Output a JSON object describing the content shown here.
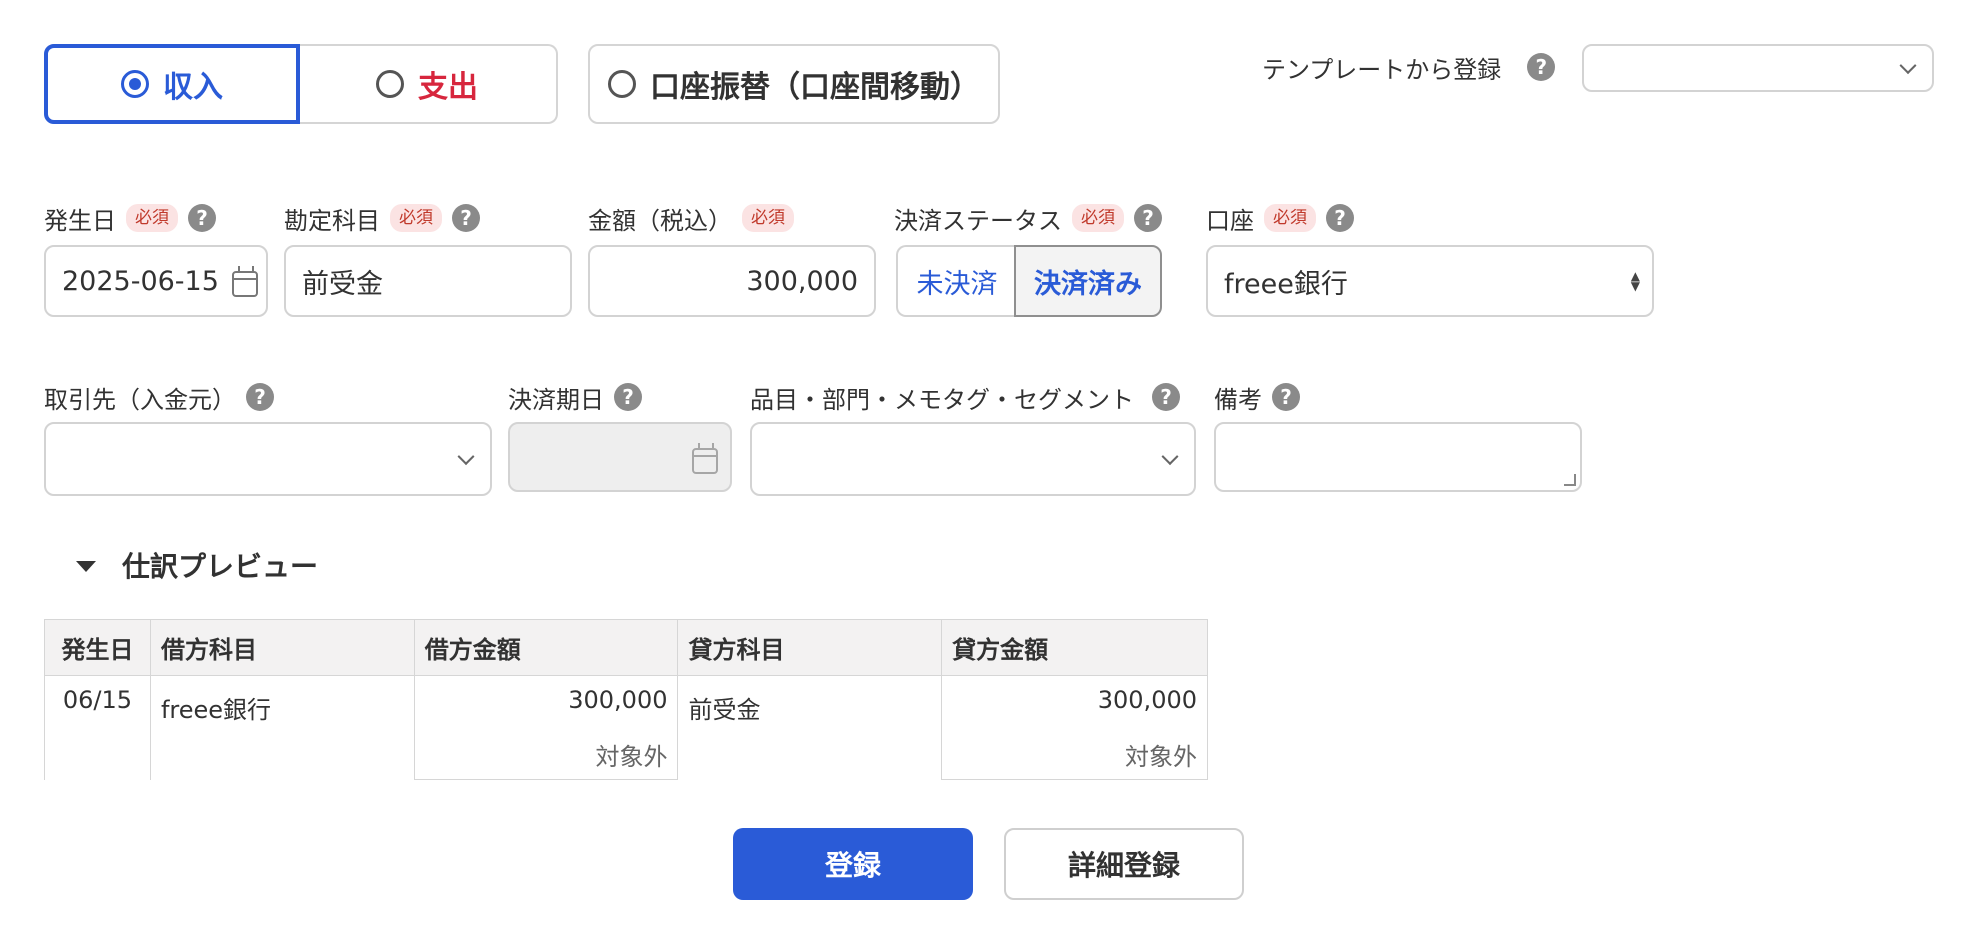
{
  "type_tabs": [
    {
      "label": "収入",
      "selected": true
    },
    {
      "label": "支出",
      "selected": false
    },
    {
      "label": "口座振替（口座間移動）",
      "selected": false
    }
  ],
  "template": {
    "label": "テンプレートから登録",
    "value": ""
  },
  "required_badge": "必須",
  "help_glyph": "?",
  "fields": {
    "date": {
      "label": "発生日",
      "value": "2025-06-15"
    },
    "account_item": {
      "label": "勘定科目",
      "value": "前受金"
    },
    "amount": {
      "label": "金額（税込）",
      "value": "300,000"
    },
    "status": {
      "label": "決済ステータス",
      "options": [
        "未決済",
        "決済済み"
      ],
      "selected": "決済済み"
    },
    "wallet": {
      "label": "口座",
      "value": "freee銀行"
    },
    "partner": {
      "label": "取引先（入金元）",
      "value": ""
    },
    "due_date": {
      "label": "決済期日",
      "value": ""
    },
    "tags": {
      "label": "品目・部門・メモタグ・セグメント",
      "value": ""
    },
    "memo": {
      "label": "備考",
      "value": ""
    }
  },
  "preview": {
    "title": "仕訳プレビュー",
    "headers": [
      "発生日",
      "借方科目",
      "借方金額",
      "貸方科目",
      "貸方金額"
    ],
    "row": {
      "date": "06/15",
      "debit_item": "freee銀行",
      "debit_amount": "300,000",
      "debit_tax": "対象外",
      "credit_item": "前受金",
      "credit_amount": "300,000",
      "credit_tax": "対象外"
    }
  },
  "actions": {
    "register": "登録",
    "detail": "詳細登録"
  },
  "colors": {
    "primary": "#2a5bd7",
    "expense": "#d7263d",
    "required_bg": "#fbe3e3"
  }
}
